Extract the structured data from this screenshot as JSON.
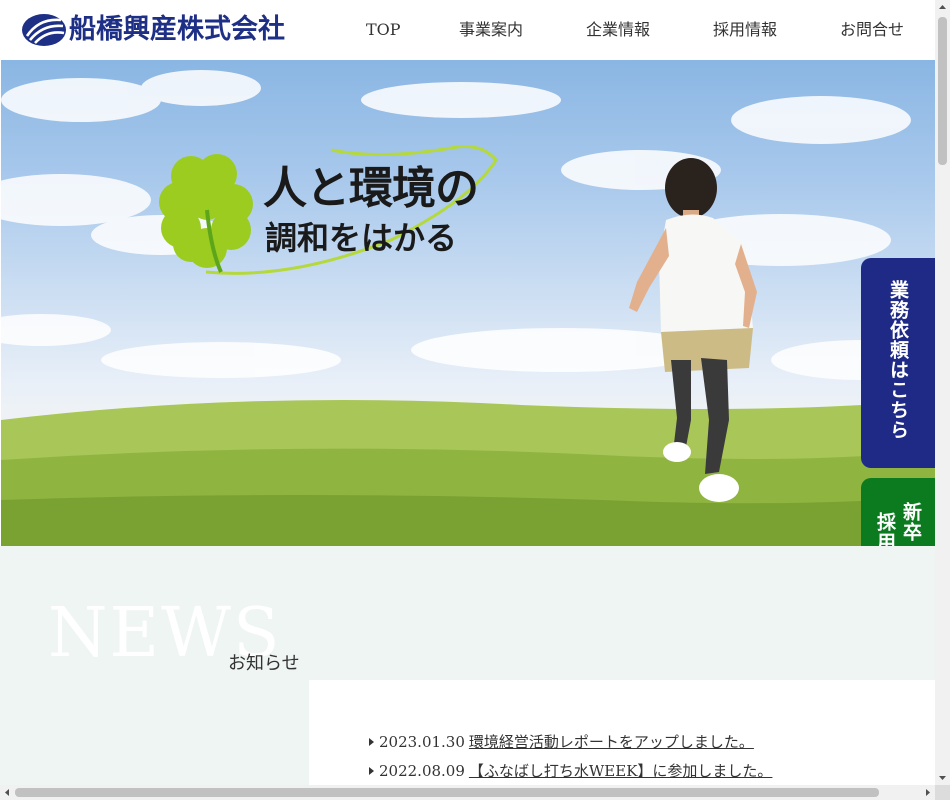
{
  "header": {
    "logo_text": "船橋興産株式会社",
    "nav": [
      {
        "label": "TOP"
      },
      {
        "label": "事業案内"
      },
      {
        "label": "企業情報"
      },
      {
        "label": "採用情報"
      },
      {
        "label": "お問合せ"
      }
    ]
  },
  "hero": {
    "tagline_line1": "人と環境の",
    "tagline_line2": "調和をはかる",
    "clover_icon": "clover-icon"
  },
  "side_buttons": {
    "request_label": "業務依頼はこちら",
    "recruit_col1": "新卒・中途",
    "recruit_col2": "採用情報"
  },
  "news": {
    "heading": "NEWS",
    "subheading": "お知らせ",
    "items": [
      {
        "date": "2023.01.30",
        "title": "環境経営活動レポートをアップしました。"
      },
      {
        "date": "2022.08.09",
        "title": "【ふなばし打ち水WEEK】に参加しました。"
      }
    ]
  },
  "colors": {
    "brand_blue": "#1e2a86",
    "recruit_green": "#0c7a1f",
    "news_bg": "#eff5f2"
  }
}
